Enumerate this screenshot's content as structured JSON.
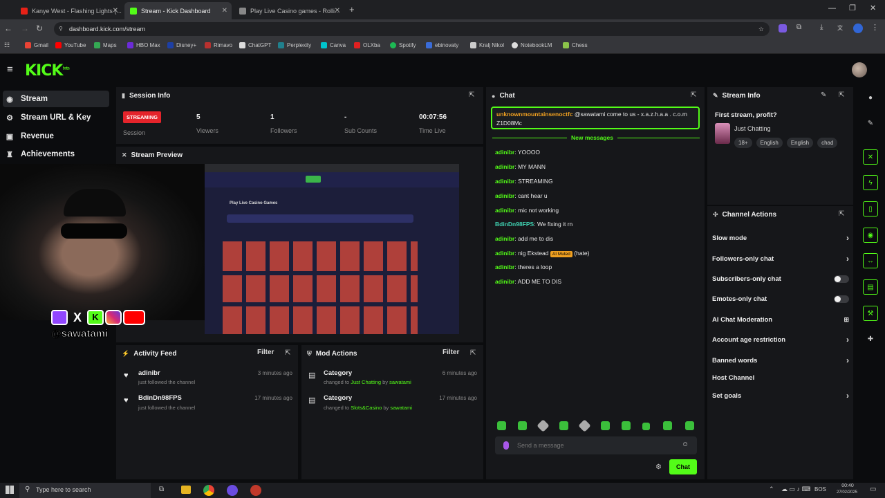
{
  "browser": {
    "tabs": [
      {
        "label": "Kanye West - Flashing Lights (..."
      },
      {
        "label": "Stream - Kick Dashboard"
      },
      {
        "label": "Play Live Casino games - Rolli..."
      }
    ],
    "url": "dashboard.kick.com/stream",
    "bookmarks": [
      "Gmail",
      "YouTube",
      "Maps",
      "HBO Max",
      "Disney+",
      "Rimavo",
      "ChatGPT",
      "Perplexity",
      "Canva",
      "OLXba",
      "Spotify",
      "ebinovaty",
      "Kralj Nikol",
      "NotebookLM",
      "Chess"
    ]
  },
  "header": {
    "logo": "KICK",
    "logo_sup": "beta"
  },
  "sidebar": {
    "items": [
      {
        "label": "Stream",
        "icon": "broadcast-icon"
      },
      {
        "label": "Stream URL & Key",
        "icon": "key-icon"
      },
      {
        "label": "Revenue",
        "icon": "money-icon"
      },
      {
        "label": "Achievements",
        "icon": "trophy-icon"
      }
    ]
  },
  "session": {
    "title": "Session Info",
    "status": "STREAMING",
    "status_label": "Session",
    "stats": [
      {
        "value": "5",
        "label": "Viewers"
      },
      {
        "value": "1",
        "label": "Followers"
      },
      {
        "value": "-",
        "label": "Sub Counts"
      },
      {
        "value": "00:07:56",
        "label": "Time Live"
      }
    ]
  },
  "preview": {
    "title": "Stream Preview",
    "casino_heading": "Play Live Casino Games"
  },
  "overlay": {
    "handle": "@sawatami"
  },
  "activity": {
    "title": "Activity Feed",
    "filter": "Filter",
    "items": [
      {
        "name": "adinibr",
        "sub": "just followed the channel",
        "time": "3 minutes ago"
      },
      {
        "name": "BdinDn98FPS",
        "sub": "just followed the channel",
        "time": "17 minutes ago"
      }
    ]
  },
  "mod": {
    "title": "Mod Actions",
    "filter": "Filter",
    "items": [
      {
        "name": "Category",
        "prefix": "changed to",
        "target": "Just Chatting",
        "by": "by",
        "user": "sawatami",
        "time": "6 minutes ago"
      },
      {
        "name": "Category",
        "prefix": "changed to",
        "target": "Slots&Casino",
        "by": "by",
        "user": "sawatami",
        "time": "17 minutes ago"
      }
    ]
  },
  "chat": {
    "title": "Chat",
    "pinned_user": "unknownmountainsenoctfc",
    "pinned_text": "@sawatami come to us - x.a.z.h.a.a . c.o.m Z1D08Mc",
    "new_messages": "New messages",
    "messages": [
      {
        "user": "adinibr",
        "text": "YOOOO"
      },
      {
        "user": "adinibr",
        "text": "MY MANN"
      },
      {
        "user": "adinibr",
        "text": "STREAMING"
      },
      {
        "user": "adinibr",
        "text": "cant hear u"
      },
      {
        "user": "adinibr",
        "text": "mic not working"
      },
      {
        "user": "BdinDn98FPS",
        "text": "We fixing it rn"
      },
      {
        "user": "adinibr",
        "text": "add me to dis"
      },
      {
        "user": "adinibr",
        "text": "nig Ekstead",
        "badge": "AI Muted",
        "suffix": "(hate)"
      },
      {
        "user": "adinibr",
        "text": "theres a loop"
      },
      {
        "user": "adinibr",
        "text": "ADD ME TO DIS"
      }
    ],
    "placeholder": "Send a message",
    "send_label": "Chat"
  },
  "stream_info": {
    "title": "Stream Info",
    "stream_title": "First stream, profit?",
    "category": "Just Chatting",
    "tags": [
      "18+",
      "English",
      "English",
      "chad"
    ]
  },
  "channel_actions": {
    "title": "Channel Actions",
    "items": [
      {
        "label": "Slow mode",
        "control": "chevron"
      },
      {
        "label": "Followers-only chat",
        "control": "chevron"
      },
      {
        "label": "Subscribers-only chat",
        "control": "toggle"
      },
      {
        "label": "Emotes-only chat",
        "control": "toggle"
      },
      {
        "label": "AI Chat Moderation",
        "control": "icon"
      },
      {
        "label": "Account age restriction",
        "control": "chevron"
      },
      {
        "label": "Banned words",
        "control": "chevron"
      },
      {
        "label": "Host Channel",
        "control": "none"
      },
      {
        "label": "Set goals",
        "control": "chevron"
      }
    ]
  },
  "taskbar": {
    "search_placeholder": "Type here to search",
    "time": "00:40",
    "date": "27/02/2025",
    "lang": "BOS"
  },
  "colors": {
    "accent": "#53fc18",
    "live": "#e5242b",
    "panel": "#16171a",
    "background": "#0b0c0e"
  }
}
